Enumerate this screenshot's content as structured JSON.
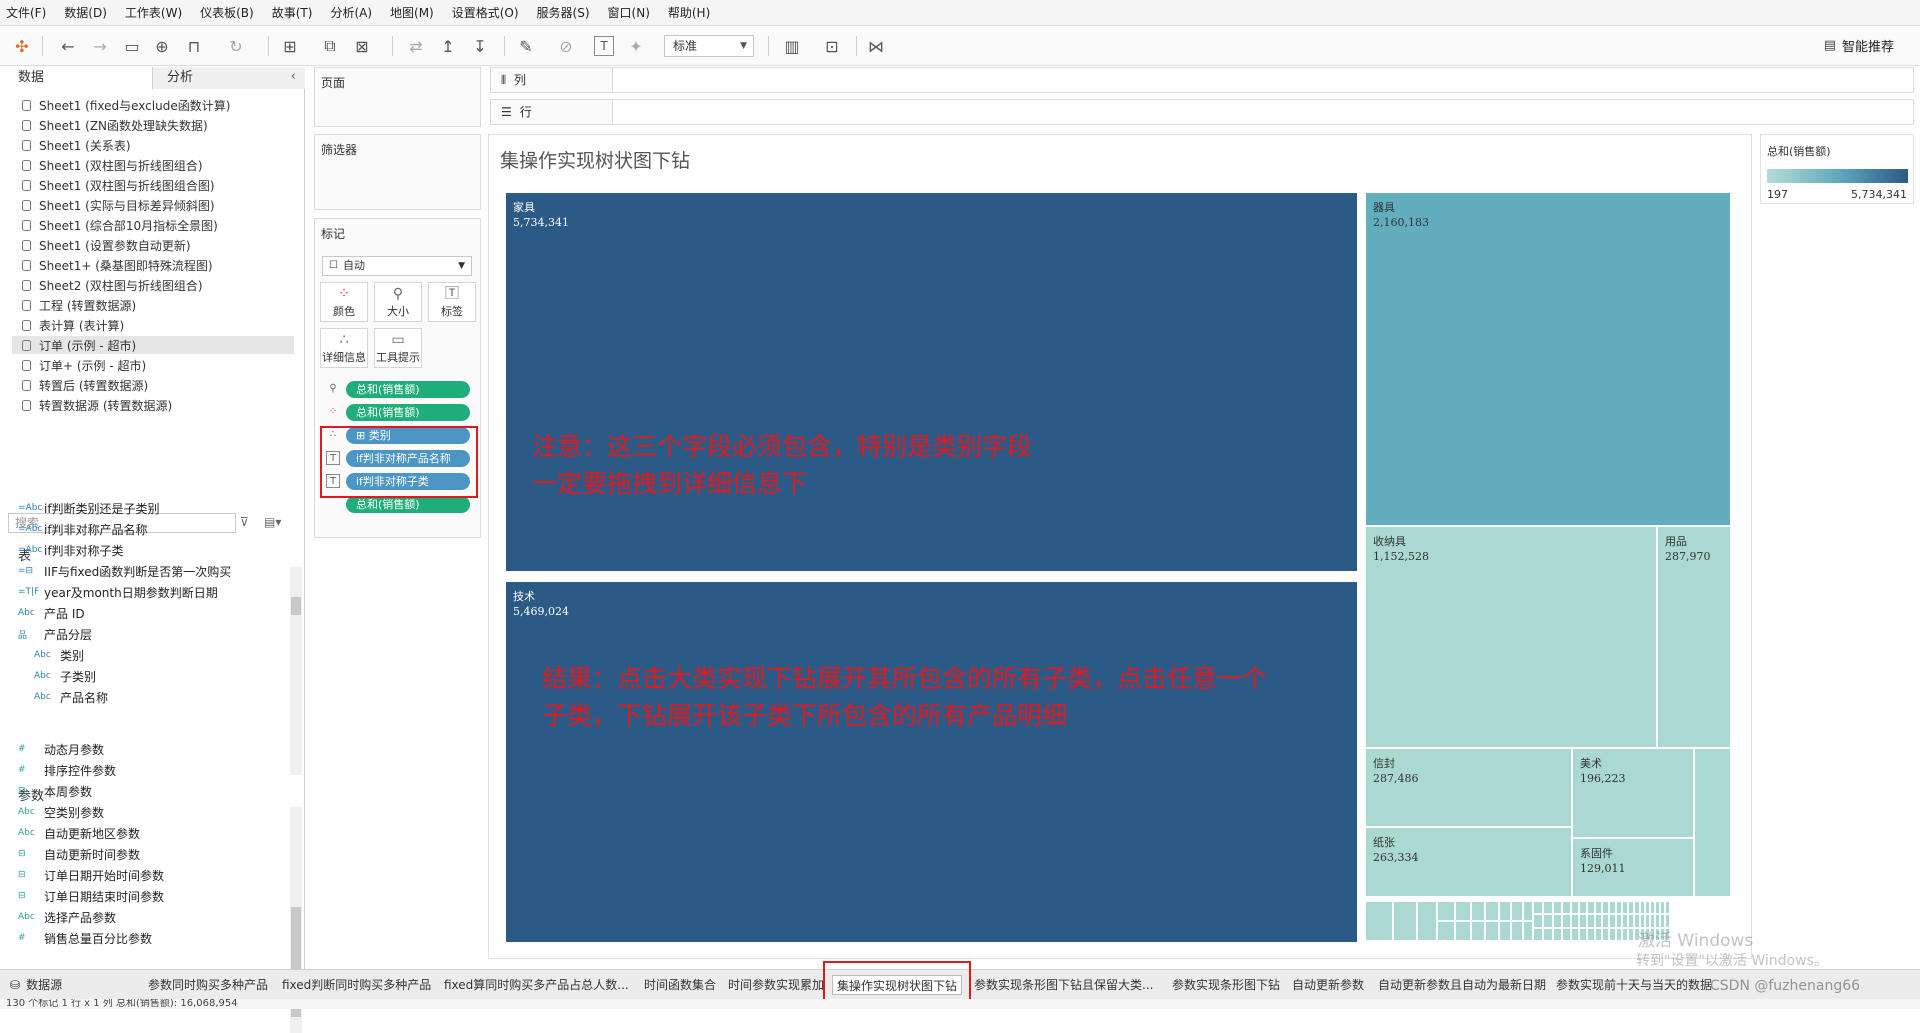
{
  "menu": [
    "文件(F)",
    "数据(D)",
    "工作表(W)",
    "仪表板(B)",
    "故事(T)",
    "分析(A)",
    "地图(M)",
    "设置格式(O)",
    "服务器(S)",
    "窗口(N)",
    "帮助(H)"
  ],
  "toolbar": {
    "standard_select": "标准",
    "smart_recommend": "智能推荐"
  },
  "left_pane": {
    "tab_data": "数据",
    "tab_analysis": "分析",
    "datasources": [
      "Sheet1 (fixed与exclude函数计算)",
      "Sheet1 (ZN函数处理缺失数据)",
      "Sheet1 (关系表)",
      "Sheet1 (双柱图与折线图组合)",
      "Sheet1 (双柱图与折线图组合图)",
      "Sheet1 (实际与目标差异倾斜图)",
      "Sheet1 (综合部10月指标全景图)",
      "Sheet1 (设置参数自动更新)",
      "Sheet1+ (桑基图即特殊流程图)",
      "Sheet2 (双柱图与折线图组合)",
      "工程 (转置数据源)",
      "表计算 (表计算)",
      "订单 (示例 - 超市)",
      "订单+ (示例 - 超市)",
      "转置后 (转置数据源)",
      "转置数据源 (转置数据源)"
    ],
    "search_placeholder": "搜索",
    "tables_header": "表",
    "fields": [
      {
        "icon": "=Abc",
        "label": "if判断类别还是子类别"
      },
      {
        "icon": "=Abc",
        "label": "if判非对称产品名称"
      },
      {
        "icon": "=Abc",
        "label": "if判非对称子类"
      },
      {
        "icon": "=⊟",
        "label": "IIF与fixed函数判断是否第一次购买"
      },
      {
        "icon": "=T|F",
        "label": "year及month日期参数判断日期"
      },
      {
        "icon": "Abc",
        "label": "产品 ID"
      },
      {
        "icon": "品",
        "label": "产品分层"
      },
      {
        "icon": "Abc",
        "label": "类别"
      },
      {
        "icon": "Abc",
        "label": "子类别"
      },
      {
        "icon": "Abc",
        "label": "产品名称"
      }
    ],
    "params_header": "参数",
    "params": [
      {
        "icon": "#",
        "label": "动态月参数"
      },
      {
        "icon": "#",
        "label": "排序控件参数"
      },
      {
        "icon": "⊟",
        "label": "本周参数"
      },
      {
        "icon": "Abc",
        "label": "空类别参数"
      },
      {
        "icon": "Abc",
        "label": "自动更新地区参数"
      },
      {
        "icon": "⊟",
        "label": "自动更新时间参数"
      },
      {
        "icon": "⊟",
        "label": "订单日期开始时间参数"
      },
      {
        "icon": "⊟",
        "label": "订单日期结束时间参数"
      },
      {
        "icon": "Abc",
        "label": "选择产品参数"
      },
      {
        "icon": "#",
        "label": "销售总量百分比参数"
      }
    ]
  },
  "cards": {
    "pages": "页面",
    "filters": "筛选器",
    "marks": "标记",
    "marks_type": "自动",
    "buttons": [
      "颜色",
      "大小",
      "标签",
      "详细信息",
      "工具提示"
    ],
    "pills": [
      "总和(销售额)",
      "总和(销售额)",
      "⊞ 类别",
      "if判非对称产品名称",
      "if判非对称子类",
      "总和(销售额)"
    ]
  },
  "shelves": {
    "columns": "列",
    "rows": "行"
  },
  "viz": {
    "title": "集操作实现树状图下钻",
    "legend_title": "总和(销售额)",
    "legend_min": "197",
    "legend_max": "5,734,341",
    "colors": {
      "dark": "#2c5a87",
      "mid": "#62aebf",
      "light": "#a9d9d1"
    },
    "tiles": [
      {
        "name": "家具",
        "value": "5,734,341"
      },
      {
        "name": "技术",
        "value": "5,469,024"
      },
      {
        "name": "器具",
        "value": "2,160,183"
      },
      {
        "name": "收纳具",
        "value": "1,152,528"
      },
      {
        "name": "用品",
        "value": "287,970"
      },
      {
        "name": "信封",
        "value": "287,486"
      },
      {
        "name": "美术",
        "value": "196,223"
      },
      {
        "name": "纸张",
        "value": "263,334"
      },
      {
        "name": "系固件",
        "value": "129,011"
      }
    ],
    "note1_line1": "注意：这三个字段必须包含，特别是类别字段",
    "note1_line2": "一定要拖拽到详细信息下",
    "note2_line1": "结果：点击大类实现下钻展开其所包含的所有子类，点击任意一个",
    "note2_line2": "子类，下钻展开该子类下所包含的所有产品明细"
  },
  "sheet_tabs": {
    "datasource": "数据源",
    "tabs": [
      "参数同时购买多种产品",
      "fixed判断同时购买多种产品",
      "fixed算同时购买多产品占总人数...",
      "时间函数集合",
      "时间参数实现累加",
      "集操作实现树状图下钻",
      "参数实现条形图下钻且保留大类...",
      "参数实现条形图下钻",
      "自动更新参数",
      "自动更新参数且自动为最新日期",
      "参数实现前十天与当天的数据"
    ],
    "active_index": 5
  },
  "status": {
    "text": "130 个标记    1 行 x 1 列    总和(销售额): 16,068,954"
  },
  "watermark": {
    "line1": "激活 Windows",
    "line2": "转到\"设置\"以激活 Windows。",
    "csdn": "CSDN @fuzhenang66"
  }
}
